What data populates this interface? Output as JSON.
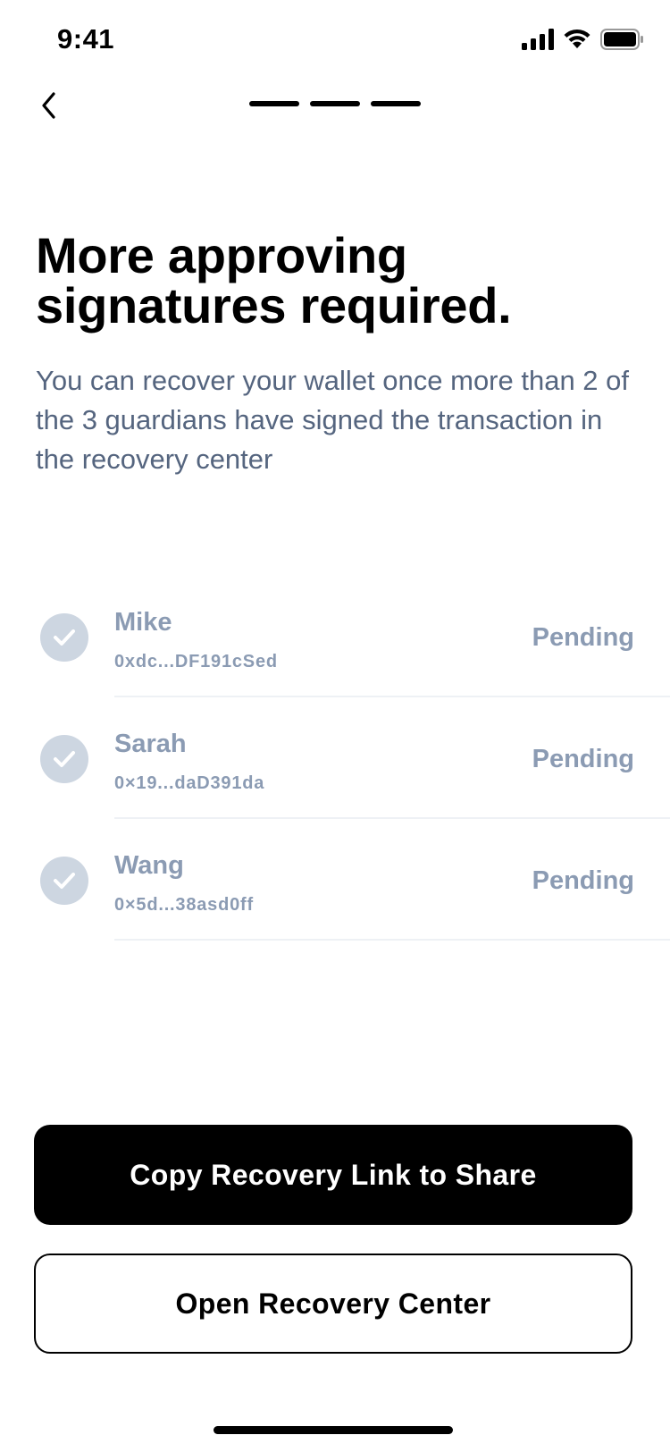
{
  "status_bar": {
    "time": "9:41"
  },
  "nav": {
    "back_icon": "chevron-left-icon",
    "progress_steps": 3
  },
  "header": {
    "title": "More approving signatures required.",
    "subtitle": "You can recover your wallet once more than 2 of the 3 guardians have signed the transaction in the recovery center"
  },
  "guardians": [
    {
      "name": "Mike",
      "address": "0xdc...DF191cSed",
      "status": "Pending"
    },
    {
      "name": "Sarah",
      "address": "0×19...daD391da",
      "status": "Pending"
    },
    {
      "name": "Wang",
      "address": "0×5d...38asd0ff",
      "status": "Pending"
    }
  ],
  "actions": {
    "copy_link_label": "Copy Recovery Link to Share",
    "open_center_label": "Open Recovery Center"
  },
  "colors": {
    "accent": "#000000",
    "muted_text": "#8b9bb3",
    "subtitle_text": "#55657f",
    "check_circle": "#cdd6e1"
  }
}
